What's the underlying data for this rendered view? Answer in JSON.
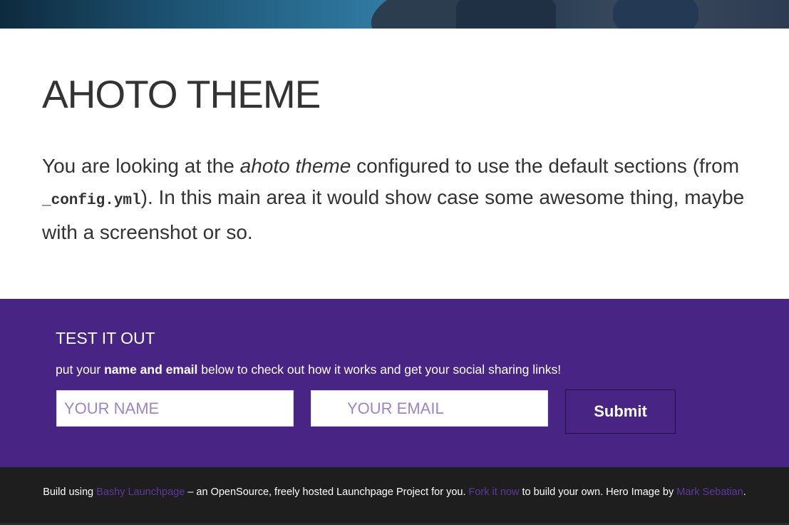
{
  "colors": {
    "accent": "#482584",
    "footer_bg": "#1e1e1e",
    "link": "#5a3a9e",
    "placeholder": "#9b85c4"
  },
  "main": {
    "title": "AHOTO THEME",
    "lead_part1": "You are looking at the ",
    "lead_em": "ahoto theme",
    "lead_part2": " configured to use the default sections (from ",
    "lead_code": "_config.yml",
    "lead_part3": "). In this main area it would show case some awesome thing, maybe with a screenshot or so."
  },
  "signup": {
    "heading": "TEST IT OUT",
    "sub_part1": "put your ",
    "sub_bold": "name and email",
    "sub_part2": " below to check out how it works and get your social sharing links!",
    "name_placeholder": "YOUR NAME",
    "email_placeholder": "YOUR EMAIL",
    "submit_label": "Submit"
  },
  "footer": {
    "text1": "Build using ",
    "link1": "Bashy Launchpage",
    "text2": " – an OpenSource, freely hosted Launchpage Project for you. ",
    "link2": "Fork it now",
    "text3": " to build your own. Hero Image by ",
    "link3": "Mark Sebatian",
    "text4": "."
  }
}
